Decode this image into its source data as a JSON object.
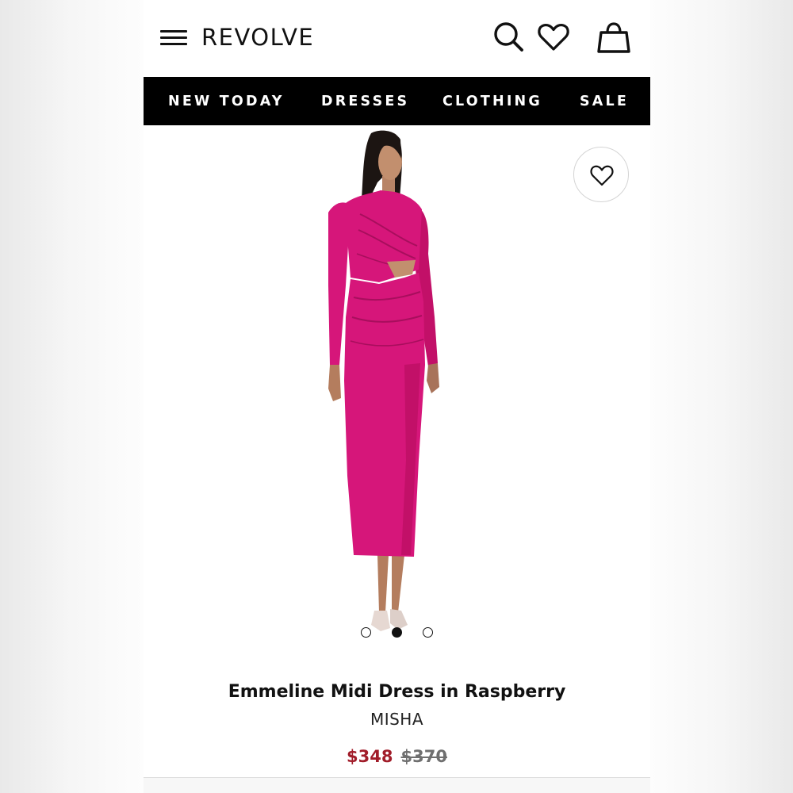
{
  "header": {
    "logo": "REVOLVE",
    "menu_icon": "hamburger-menu-icon",
    "search_icon": "search-icon",
    "wishlist_icon": "heart-icon",
    "bag_icon": "shopping-bag-icon"
  },
  "nav": {
    "items": [
      {
        "label": "NEW TODAY"
      },
      {
        "label": "DRESSES"
      },
      {
        "label": "CLOTHING"
      },
      {
        "label": "SALE"
      }
    ]
  },
  "product": {
    "title": "Emmeline Midi Dress in Raspberry",
    "brand": "MISHA",
    "price_sale": "$348",
    "price_original": "$370",
    "dress_color": "#d6167a",
    "sale_price_color": "#a11d2a",
    "gallery": {
      "image_count": 3,
      "active_index": 1
    }
  }
}
